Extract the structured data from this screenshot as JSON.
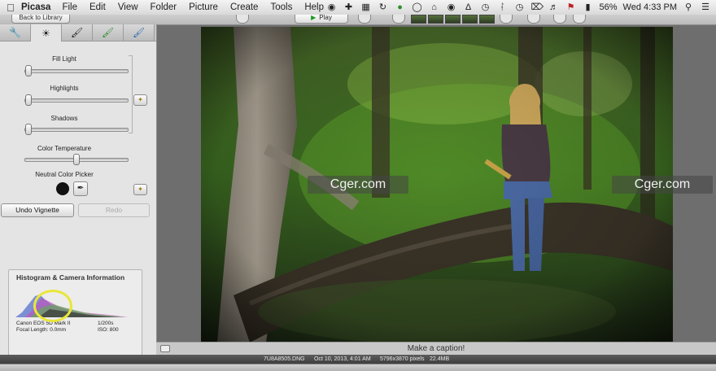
{
  "menubar": {
    "app_name": "Picasa",
    "items": [
      "File",
      "Edit",
      "View",
      "Folder",
      "Picture",
      "Create",
      "Tools",
      "Help"
    ],
    "battery": "56%",
    "clock": "Wed 4:33 PM"
  },
  "toolbar": {
    "back_label": "Back to Library",
    "play_label": "Play"
  },
  "panel": {
    "tabs": [
      "wrench-icon",
      "sun-icon",
      "brush-icon",
      "green-brush-icon",
      "blue-brush-icon"
    ],
    "sliders": {
      "fill_light": {
        "label": "Fill Light",
        "value": 0.0
      },
      "highlights": {
        "label": "Highlights",
        "value": 0.0
      },
      "shadows": {
        "label": "Shadows",
        "value": 0.0
      },
      "color_temperature": {
        "label": "Color Temperature",
        "value": 0.5
      }
    },
    "neutral_label": "Neutral Color Picker",
    "undo_label": "Undo Vignette",
    "redo_label": "Redo"
  },
  "histogram": {
    "title": "Histogram & Camera Information",
    "camera": "Canon EOS 5D Mark II",
    "focal": "Focal Length: 0.0mm",
    "shutter": "1/200s",
    "iso": "ISO: 800"
  },
  "caption": {
    "placeholder": "Make a caption!"
  },
  "status": {
    "filename": "7U8A8505.DNG",
    "date": "Oct 10, 2013, 4:01 AM",
    "dims": "5796x3870 pixels",
    "size": "22.4MB"
  },
  "watermark": {
    "left": "Cger.com",
    "right": "Cger.com"
  },
  "colors": {
    "accent_green": "#1c9a1c",
    "highlight_ring": "#e9e63a"
  }
}
